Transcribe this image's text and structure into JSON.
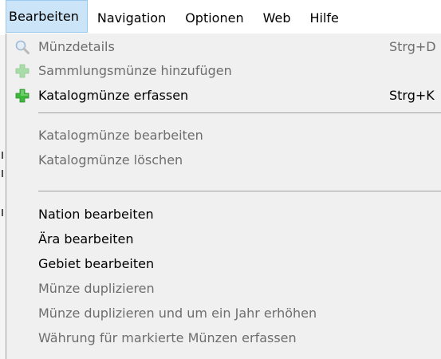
{
  "menubar": {
    "items": [
      {
        "label": "Bearbeiten"
      },
      {
        "label": "Navigation"
      },
      {
        "label": "Optionen"
      },
      {
        "label": "Web"
      },
      {
        "label": "Hilfe"
      }
    ]
  },
  "dropdown": {
    "items": [
      {
        "label": "Münzdetails",
        "shortcut": "Strg+D",
        "icon": "magnifier-icon",
        "enabled": false
      },
      {
        "label": "Sammlungsmünze hinzufügen",
        "shortcut": "",
        "icon": "plus-icon",
        "enabled": false
      },
      {
        "label": "Katalogmünze erfassen",
        "shortcut": "Strg+K",
        "icon": "plus-icon",
        "enabled": true
      },
      {
        "label": "Katalogmünze bearbeiten",
        "shortcut": "",
        "enabled": false
      },
      {
        "label": "Katalogmünze löschen",
        "shortcut": "",
        "enabled": false
      },
      {
        "label": "Nation bearbeiten",
        "shortcut": "",
        "enabled": true
      },
      {
        "label": "Ära bearbeiten",
        "shortcut": "",
        "enabled": true
      },
      {
        "label": "Gebiet bearbeiten",
        "shortcut": "",
        "enabled": true
      },
      {
        "label": "Münze duplizieren",
        "shortcut": "",
        "enabled": false
      },
      {
        "label": "Münze duplizieren und um ein Jahr erhöhen",
        "shortcut": "",
        "enabled": false
      },
      {
        "label": "Währung für markierte Münzen erfassen",
        "shortcut": "",
        "enabled": false
      }
    ]
  },
  "colors": {
    "menubar_active_bg": "#cce4f7",
    "menubar_active_border": "#99c9ef",
    "menu_bg": "#f0f0f0",
    "disabled_text": "#6d6d6d",
    "plus_enabled": "#3db83d",
    "plus_disabled": "#a8dca8"
  }
}
